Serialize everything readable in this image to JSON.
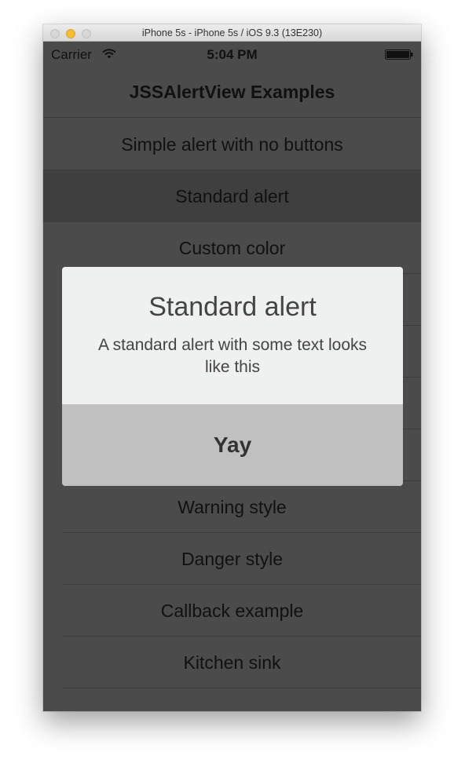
{
  "window": {
    "title": "iPhone 5s - iPhone 5s / iOS 9.3 (13E230)"
  },
  "status_bar": {
    "carrier": "Carrier",
    "time": "5:04 PM"
  },
  "nav": {
    "title": "JSSAlertView Examples"
  },
  "list": {
    "items": [
      {
        "label": "Simple alert with no buttons"
      },
      {
        "label": "Standard alert"
      },
      {
        "label": "Custom color"
      },
      {
        "label": ""
      },
      {
        "label": ""
      },
      {
        "label": ""
      },
      {
        "label": ""
      },
      {
        "label": "Warning style"
      },
      {
        "label": "Danger style"
      },
      {
        "label": "Callback example"
      },
      {
        "label": "Kitchen sink"
      }
    ]
  },
  "alert": {
    "title": "Standard alert",
    "text": "A standard alert with some text looks like this",
    "button_label": "Yay"
  },
  "colors": {
    "screen_bg": "#4b4b4b",
    "alert_bg": "#eff1f0",
    "alert_button_bg": "#bfc0bf"
  }
}
